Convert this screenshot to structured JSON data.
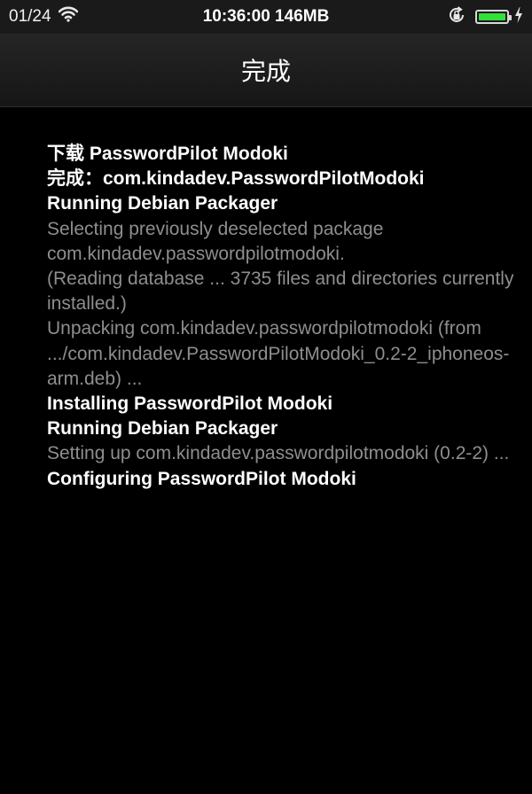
{
  "status_bar": {
    "date": "01/24",
    "time_memory": "10:36:00 146MB",
    "battery_level_percent": 100,
    "battery_color": "#33e03a",
    "icons": [
      "wifi-icon",
      "rotation-lock-icon",
      "battery-icon",
      "charging-bolt-icon"
    ]
  },
  "nav": {
    "title": "完成"
  },
  "log": [
    {
      "style": "bold",
      "text": "下载 PasswordPilot Modoki"
    },
    {
      "style": "bold",
      "text": "完成：com.kindadev.PasswordPilotModoki"
    },
    {
      "style": "bold",
      "text": "Running Debian Packager"
    },
    {
      "style": "dim",
      "text": "Selecting previously deselected package com.kindadev.passwordpilotmodoki."
    },
    {
      "style": "dim",
      "text": "(Reading database ... 3735 files and directories currently installed.)"
    },
    {
      "style": "dim",
      "text": "Unpacking com.kindadev.passwordpilotmodoki (from .../com.kindadev.PasswordPilotModoki_0.2-2_iphoneos-arm.deb) ..."
    },
    {
      "style": "bold",
      "text": "Installing PasswordPilot Modoki"
    },
    {
      "style": "bold",
      "text": "Running Debian Packager"
    },
    {
      "style": "dim",
      "text": "Setting up com.kindadev.passwordpilotmodoki (0.2-2) ..."
    },
    {
      "style": "bold",
      "text": "Configuring PasswordPilot Modoki"
    }
  ]
}
